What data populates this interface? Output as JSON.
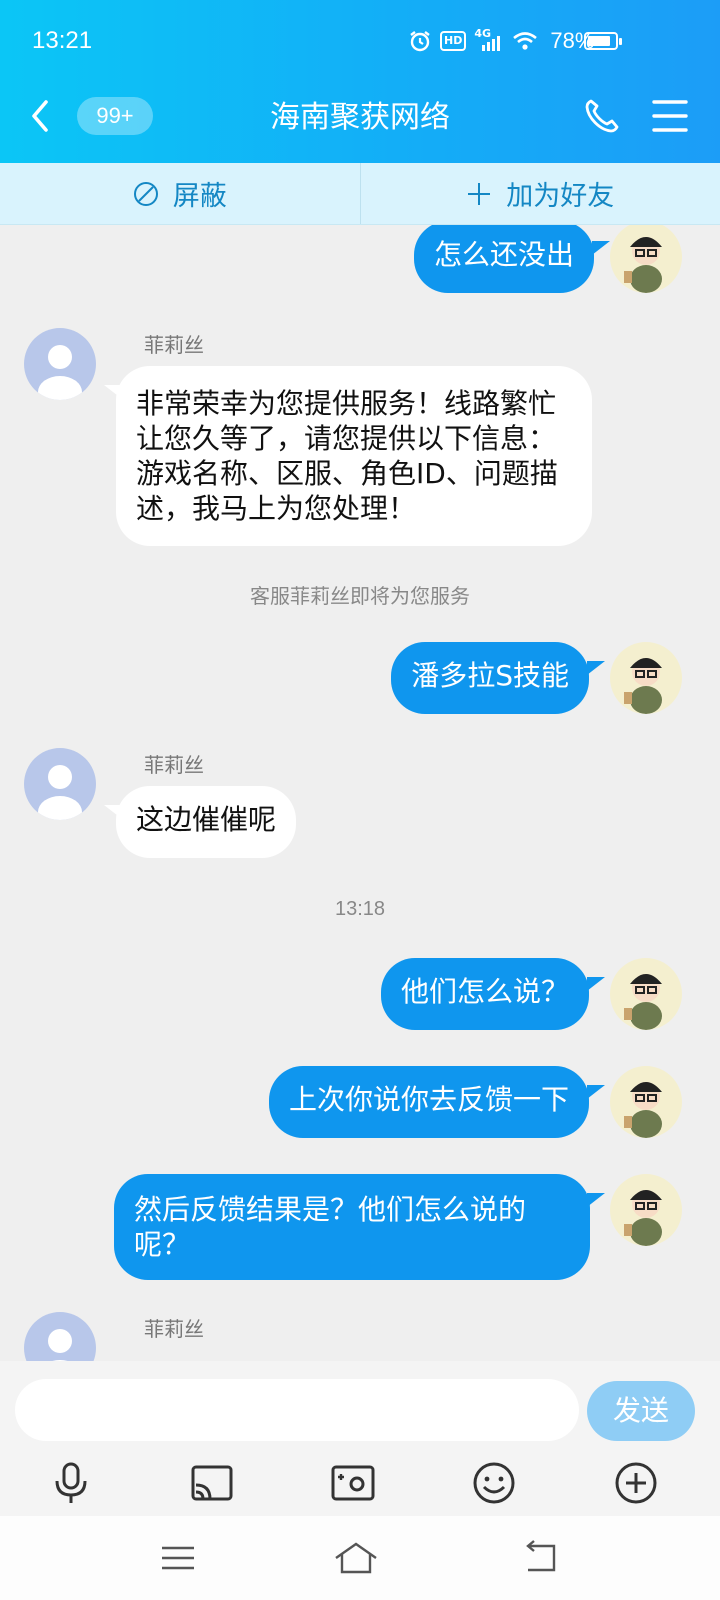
{
  "status": {
    "time": "13:21",
    "network": "4G",
    "hd": "HD",
    "battery": "78%",
    "battery_level": 0.78,
    "icons": [
      "alarm-icon",
      "hd-icon",
      "signal-icon",
      "wifi-icon",
      "battery-icon"
    ]
  },
  "header": {
    "unread": "99+",
    "title": "海南聚获网络"
  },
  "actions": {
    "block": "屏蔽",
    "add_friend": "加为好友"
  },
  "messages": [
    {
      "dir": "out",
      "text": "怎么还没出"
    },
    {
      "dir": "in",
      "sender": "菲莉丝",
      "text": "非常荣幸为您提供服务！线路繁忙让您久等了，请您提供以下信息：游戏名称、区服、角色ID、问题描述，我马上为您处理！"
    },
    {
      "dir": "system",
      "text": "客服菲莉丝即将为您服务"
    },
    {
      "dir": "out",
      "text": "潘多拉S技能"
    },
    {
      "dir": "in",
      "sender": "菲莉丝",
      "text": "这边催催呢"
    },
    {
      "dir": "time",
      "text": "13:18"
    },
    {
      "dir": "out",
      "text": "他们怎么说？"
    },
    {
      "dir": "out",
      "text": "上次你说你去反馈一下"
    },
    {
      "dir": "out",
      "text": "然后反馈结果是？他们怎么说的呢？"
    },
    {
      "dir": "in",
      "sender": "菲莉丝",
      "text": ""
    }
  ],
  "input": {
    "value": "",
    "placeholder": "",
    "send": "发送"
  },
  "colors": {
    "header_start": "#0bc6f6",
    "header_end": "#1c9df7",
    "outgoing_bubble": "#0f96ee",
    "incoming_bubble": "#ffffff",
    "background": "#efefef",
    "send_button": "#8fcdf5"
  }
}
